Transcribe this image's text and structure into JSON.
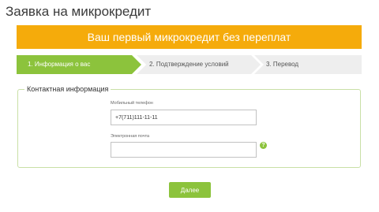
{
  "page": {
    "title": "Заявка на микрокредит"
  },
  "banner": {
    "text": "Ваш первый микрокредит без переплат"
  },
  "steps": {
    "active_index": 1,
    "items": [
      {
        "label": "1. Информация о вас"
      },
      {
        "label": "2. Подтверждение условий"
      },
      {
        "label": "3. Перевод"
      }
    ]
  },
  "contact": {
    "legend": "Контактная информация",
    "phone": {
      "label": "Мобильный телефон",
      "value": "+7(711)111-11-11"
    },
    "email": {
      "label": "Электронная почта",
      "value": ""
    },
    "help_icon": "question-mark-icon"
  },
  "actions": {
    "next_label": "Далее"
  },
  "colors": {
    "banner": "#f5ab0b",
    "accent_green": "#8cc33c",
    "step_inactive": "#eeeeee",
    "box_border": "#c9dfa6"
  }
}
